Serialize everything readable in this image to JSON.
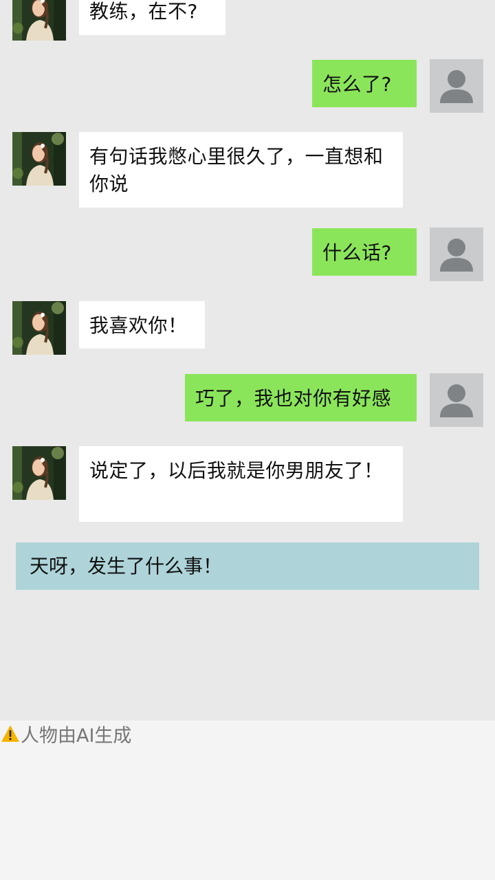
{
  "colors": {
    "chat_background": "#e9e9e9",
    "incoming_bubble": "#ffffff",
    "outgoing_bubble": "#8be55a",
    "system_banner": "#aed4d9",
    "footer_background": "#f4f4f4",
    "warning_icon": "#f4b400"
  },
  "icons": {
    "default_avatar": "user-silhouette-icon",
    "contact_avatar": "portrait-photo",
    "warning": "warning-triangle-icon"
  },
  "messages": [
    {
      "from": "contact",
      "text": "教练，在不?"
    },
    {
      "from": "self",
      "text": "怎么了?"
    },
    {
      "from": "contact",
      "text": "有句话我憋心里很久了，一直想和你说"
    },
    {
      "from": "self",
      "text": "什么话?"
    },
    {
      "from": "contact",
      "text": "我喜欢你！"
    },
    {
      "from": "self",
      "text": "巧了，我也对你有好感"
    },
    {
      "from": "contact",
      "text": "说定了，以后我就是你男朋友了！"
    }
  ],
  "system_message": "天呀，发生了什么事！",
  "footer": {
    "disclaimer": "人物由AI生成"
  }
}
